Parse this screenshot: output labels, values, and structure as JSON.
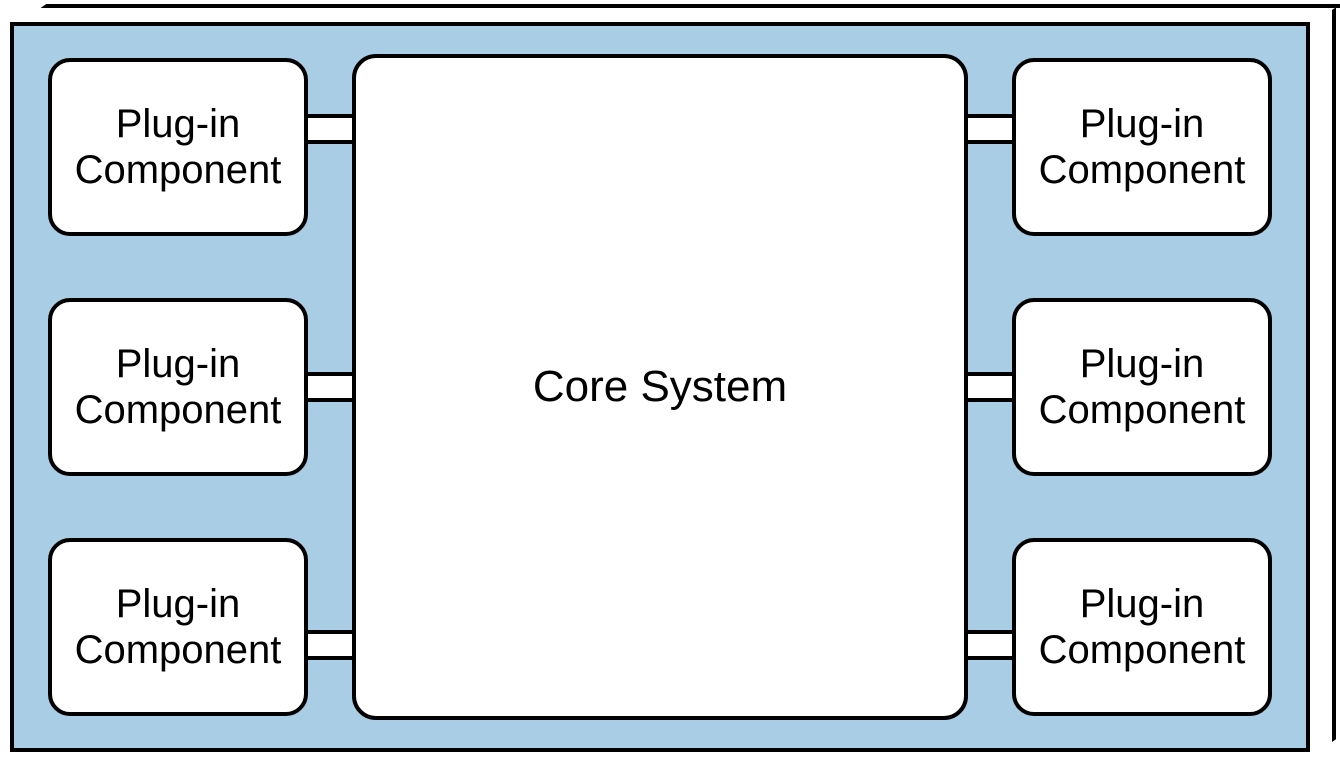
{
  "diagram": {
    "core_label": "Core System",
    "plugins_left": [
      {
        "line1": "Plug-in",
        "line2": "Component"
      },
      {
        "line1": "Plug-in",
        "line2": "Component"
      },
      {
        "line1": "Plug-in",
        "line2": "Component"
      }
    ],
    "plugins_right": [
      {
        "line1": "Plug-in",
        "line2": "Component"
      },
      {
        "line1": "Plug-in",
        "line2": "Component"
      },
      {
        "line1": "Plug-in",
        "line2": "Component"
      }
    ],
    "colors": {
      "panel_bg": "#a9cde4",
      "box_bg": "#ffffff",
      "stroke": "#000000"
    }
  }
}
